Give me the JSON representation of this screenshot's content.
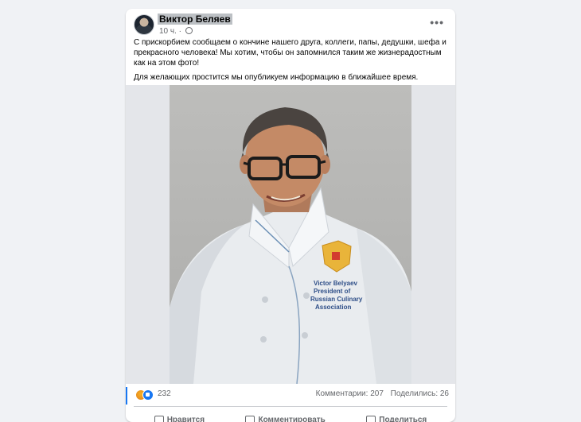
{
  "post": {
    "author": "Виктор Беляев",
    "time": "10 ч.",
    "more_label": "•••",
    "paragraph1": "С прискорбием сообщаем о кончине нашего друга, коллеги, папы, дедушки, шефа и прекрасного человека! Мы хотим, чтобы он запомнился таким же жизнерадостным как на этом фото!",
    "paragraph2": "Для желающих простится мы опубликуем информацию в ближайшее время.",
    "photo_badge": [
      "Victor Belyaev",
      "President of",
      "Russian Culinary",
      "Association"
    ]
  },
  "stats": {
    "reactions": "232",
    "comments": "Комментарии: 207",
    "shares": "Поделились: 26",
    "reaction_icons": [
      "angry-icon",
      "like-icon"
    ]
  },
  "actions": {
    "like": "Нравится",
    "comment": "Комментировать",
    "share": "Поделиться"
  },
  "colors": {
    "accent": "#1877f2",
    "background": "#f0f2f5",
    "card": "#ffffff",
    "secondary_text": "#65676b"
  }
}
